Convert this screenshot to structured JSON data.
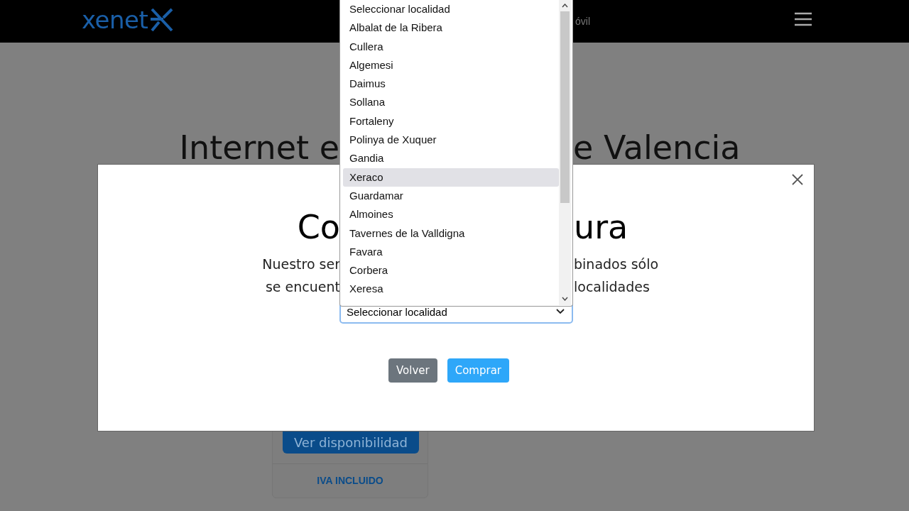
{
  "header": {
    "logo": "xenet",
    "nav_fragment": "óvil"
  },
  "page": {
    "heading_fragments": [
      "Internet e",
      "e Valencia"
    ],
    "card": {
      "button": "Ver disponibilidad",
      "note": "IVA INCLUIDO"
    }
  },
  "modal": {
    "title_fragments": [
      "Co",
      "ura"
    ],
    "text_lines": [
      [
        "Nuestro ser",
        "binados sólo"
      ],
      [
        "se encuent",
        "localidades"
      ]
    ],
    "select": {
      "value": "Seleccionar localidad",
      "expanded": true
    },
    "options": [
      {
        "label": "Seleccionar localidad",
        "selected": false
      },
      {
        "label": "Albalat de la Ribera",
        "selected": false
      },
      {
        "label": "Cullera",
        "selected": false
      },
      {
        "label": "Algemesi",
        "selected": false
      },
      {
        "label": "Daimus",
        "selected": false
      },
      {
        "label": "Sollana",
        "selected": false
      },
      {
        "label": "Fortaleny",
        "selected": false
      },
      {
        "label": "Polinya de Xuquer",
        "selected": false
      },
      {
        "label": "Gandia",
        "selected": false
      },
      {
        "label": "Xeraco",
        "selected": true
      },
      {
        "label": "Guardamar",
        "selected": false
      },
      {
        "label": "Almoines",
        "selected": false
      },
      {
        "label": "Tavernes de la Valldigna",
        "selected": false
      },
      {
        "label": "Favara",
        "selected": false
      },
      {
        "label": "Corbera",
        "selected": false
      },
      {
        "label": "Xeresa",
        "selected": false
      }
    ],
    "buttons": [
      {
        "label": "Volver",
        "kind": "secondary"
      },
      {
        "label": "Comprar",
        "kind": "primary"
      }
    ]
  }
}
